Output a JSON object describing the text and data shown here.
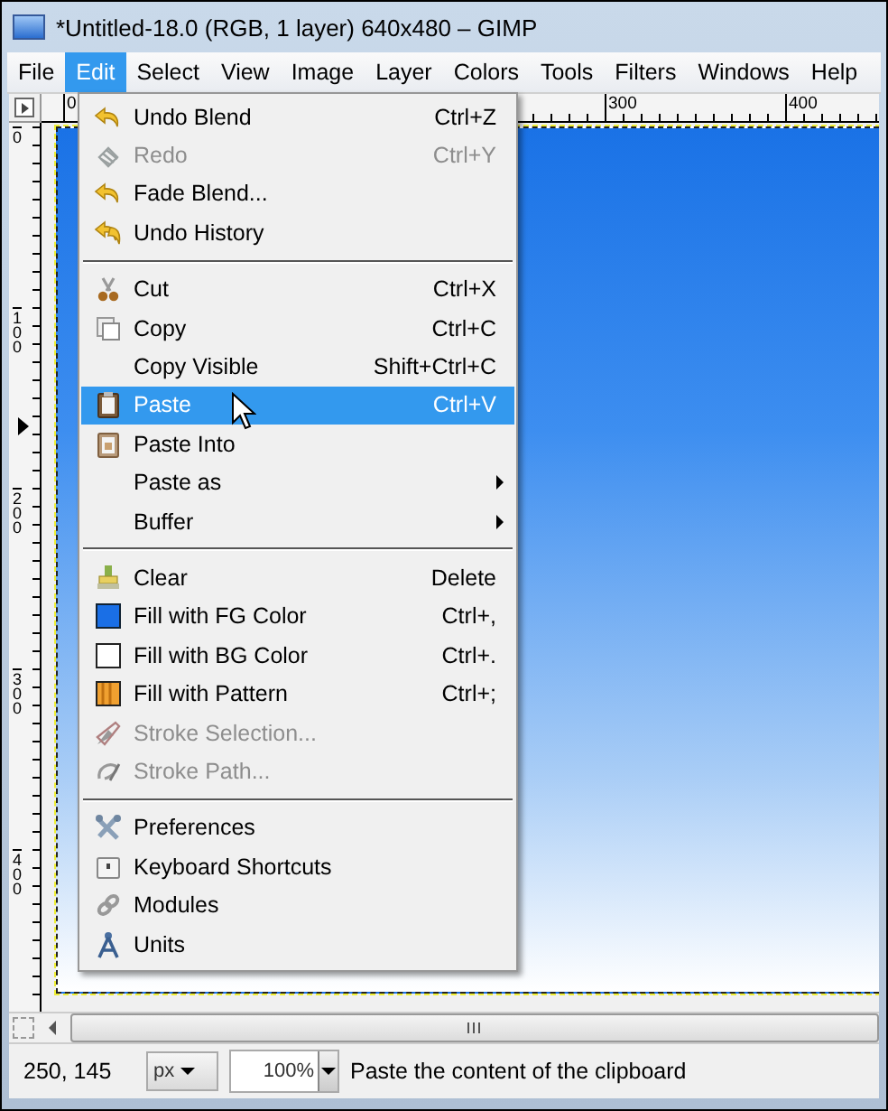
{
  "window": {
    "title": "*Untitled-18.0 (RGB, 1 layer) 640x480 – GIMP"
  },
  "menubar": [
    {
      "label": "File",
      "selected": false
    },
    {
      "label": "Edit",
      "selected": true
    },
    {
      "label": "Select",
      "selected": false
    },
    {
      "label": "View",
      "selected": false
    },
    {
      "label": "Image",
      "selected": false
    },
    {
      "label": "Layer",
      "selected": false
    },
    {
      "label": "Colors",
      "selected": false
    },
    {
      "label": "Tools",
      "selected": false
    },
    {
      "label": "Filters",
      "selected": false
    },
    {
      "label": "Windows",
      "selected": false
    },
    {
      "label": "Help",
      "selected": false
    }
  ],
  "rulers": {
    "horizontal": [
      "0",
      "300",
      "400"
    ],
    "vertical": [
      "0",
      "100",
      "200",
      "300",
      "400"
    ]
  },
  "edit_menu": [
    {
      "kind": "item",
      "label": "Undo Blend",
      "shortcut": "Ctrl+Z",
      "disabled": false,
      "selected": false,
      "submenu": false
    },
    {
      "kind": "item",
      "label": "Redo",
      "shortcut": "Ctrl+Y",
      "disabled": true,
      "selected": false,
      "submenu": false
    },
    {
      "kind": "item",
      "label": "Fade Blend...",
      "disabled": false,
      "selected": false,
      "submenu": false
    },
    {
      "kind": "item",
      "label": "Undo History",
      "disabled": false,
      "selected": false,
      "submenu": false
    },
    {
      "kind": "separator"
    },
    {
      "kind": "item",
      "label": "Cut",
      "shortcut": "Ctrl+X",
      "disabled": false,
      "selected": false,
      "submenu": false
    },
    {
      "kind": "item",
      "label": "Copy",
      "shortcut": "Ctrl+C",
      "disabled": false,
      "selected": false,
      "submenu": false
    },
    {
      "kind": "item",
      "label": "Copy Visible",
      "shortcut": "Shift+Ctrl+C",
      "disabled": false,
      "selected": false,
      "submenu": false
    },
    {
      "kind": "item",
      "label": "Paste",
      "shortcut": "Ctrl+V",
      "disabled": false,
      "selected": true,
      "submenu": false
    },
    {
      "kind": "item",
      "label": "Paste Into",
      "disabled": false,
      "selected": false,
      "submenu": false
    },
    {
      "kind": "item",
      "label": "Paste as",
      "disabled": false,
      "selected": false,
      "submenu": true
    },
    {
      "kind": "item",
      "label": "Buffer",
      "disabled": false,
      "selected": false,
      "submenu": true
    },
    {
      "kind": "separator"
    },
    {
      "kind": "item",
      "label": "Clear",
      "shortcut": "Delete",
      "disabled": false,
      "selected": false,
      "submenu": false
    },
    {
      "kind": "item",
      "label": "Fill with FG Color",
      "shortcut": "Ctrl+,",
      "disabled": false,
      "selected": false,
      "submenu": false
    },
    {
      "kind": "item",
      "label": "Fill with BG Color",
      "shortcut": "Ctrl+.",
      "disabled": false,
      "selected": false,
      "submenu": false
    },
    {
      "kind": "item",
      "label": "Fill with Pattern",
      "shortcut": "Ctrl+;",
      "disabled": false,
      "selected": false,
      "submenu": false
    },
    {
      "kind": "item",
      "label": "Stroke Selection...",
      "disabled": true,
      "selected": false,
      "submenu": false
    },
    {
      "kind": "item",
      "label": "Stroke Path...",
      "disabled": true,
      "selected": false,
      "submenu": false
    },
    {
      "kind": "separator"
    },
    {
      "kind": "item",
      "label": "Preferences",
      "disabled": false,
      "selected": false,
      "submenu": false
    },
    {
      "kind": "item",
      "label": "Keyboard Shortcuts",
      "disabled": false,
      "selected": false,
      "submenu": false
    },
    {
      "kind": "item",
      "label": "Modules",
      "disabled": false,
      "selected": false,
      "submenu": false
    },
    {
      "kind": "item",
      "label": "Units",
      "disabled": false,
      "selected": false,
      "submenu": false
    }
  ],
  "status_bar": {
    "coordinates": "250, 145",
    "unit": "px",
    "zoom": "100%",
    "message": "Paste the content of the clipboard"
  }
}
